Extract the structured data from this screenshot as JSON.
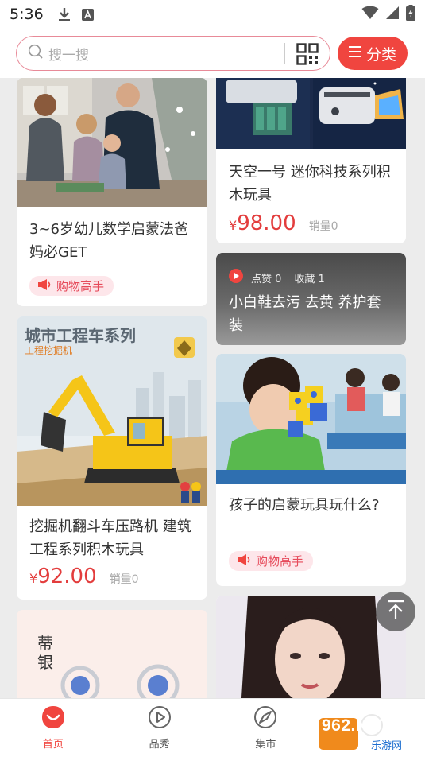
{
  "status_bar": {
    "time": "5:36"
  },
  "header": {
    "search_placeholder": "搜一搜",
    "category_button": "分类"
  },
  "feed": {
    "cards": [
      {
        "id": "c1",
        "title": "3~6岁幼儿数学启蒙法爸妈必GET",
        "tag": "购物高手"
      },
      {
        "id": "c2",
        "title": "天空一号 迷你科技系列积木玩具",
        "price_symbol": "¥",
        "price": "98.00",
        "sales": "销量0"
      },
      {
        "id": "c3",
        "title": "小白鞋去污 去黄 养护套装",
        "likes_label": "点赞 0",
        "favorites_label": "收藏 1"
      },
      {
        "id": "c4",
        "title": "挖掘机翻斗车压路机 建筑工程系列积木玩具",
        "price_symbol": "¥",
        "price": "92.00",
        "sales": "销量0",
        "banner_title": "城市工程车系列",
        "banner_subtitle": "工程挖掘机"
      },
      {
        "id": "c5",
        "title": "孩子的启蒙玩具玩什么?",
        "tag": "购物高手"
      },
      {
        "id": "c6",
        "brand_text": "蒂银"
      }
    ]
  },
  "bottom_nav": [
    {
      "label": "首页",
      "icon": "home-icon",
      "active": true
    },
    {
      "label": "品秀",
      "icon": "play-icon",
      "active": false
    },
    {
      "label": "集市",
      "icon": "compass-icon",
      "active": false
    }
  ],
  "watermark": {
    "text": "962.NET",
    "subtext": "乐游网"
  },
  "colors": {
    "accent": "#f0453f",
    "price": "#e33d3d",
    "tag_bg": "#fde6ea"
  }
}
